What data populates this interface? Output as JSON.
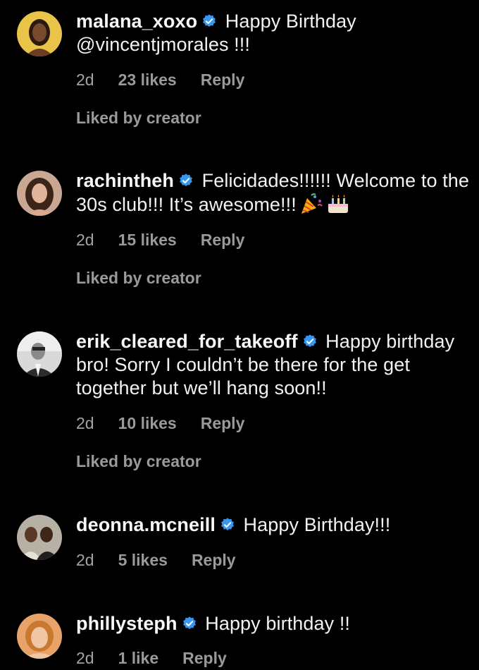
{
  "comments": [
    {
      "username": "malana_xoxo",
      "text": "Happy Birthday @vincentjmorales !!!",
      "time": "2d",
      "likes": "23 likes",
      "reply": "Reply",
      "liked_by": "Liked by creator"
    },
    {
      "username": "rachintheh",
      "text": "Felicidades!!!!!! Welcome to the 30s club!!! It’s awesome!!!",
      "time": "2d",
      "likes": "15 likes",
      "reply": "Reply",
      "liked_by": "Liked by creator"
    },
    {
      "username": "erik_cleared_for_takeoff",
      "text": "Happy birthday bro! Sorry I couldn’t be there for the get together but we’ll hang soon!!",
      "time": "2d",
      "likes": "10 likes",
      "reply": "Reply",
      "liked_by": "Liked by creator"
    },
    {
      "username": "deonna.mcneill",
      "text": "Happy Birthday!!!",
      "time": "2d",
      "likes": "5 likes",
      "reply": "Reply"
    },
    {
      "username": "phillysteph",
      "text": "Happy birthday !!",
      "time": "2d",
      "likes": "1 like",
      "reply": "Reply"
    }
  ],
  "icons": {
    "verified": "verified-badge-icon",
    "party": "party-popper-emoji",
    "cake": "birthday-cake-emoji"
  },
  "colors": {
    "background": "#000000",
    "text": "#f2f2f2",
    "muted": "#9a9a9a",
    "verified": "#3897f0"
  }
}
